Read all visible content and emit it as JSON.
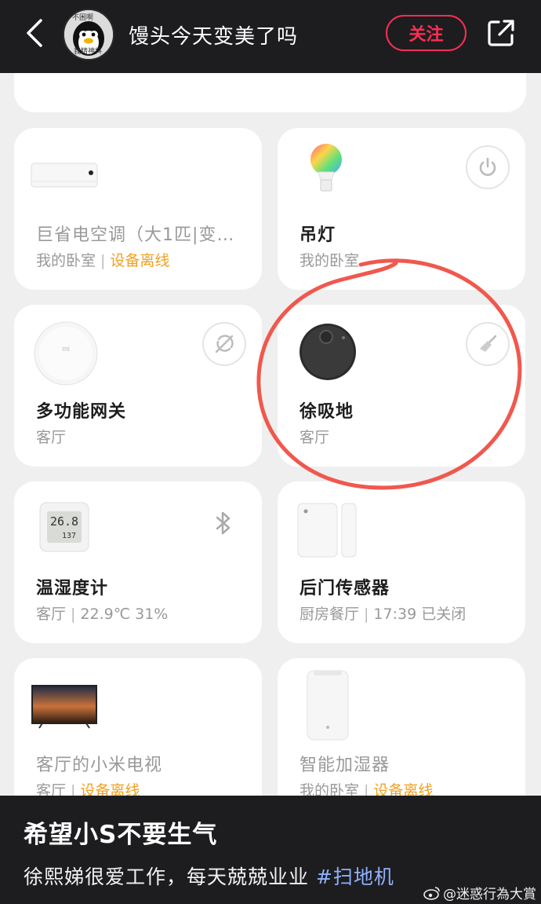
{
  "header": {
    "account_name": "馒头今天变美了吗",
    "avatar_tag_top": "不困啊",
    "avatar_tag_bottom": "我精神抖",
    "follow_label": "关注"
  },
  "devices": [
    {
      "name": "巨省电空调（大1匹|变…",
      "room": "我的卧室",
      "status": "设备离线",
      "icon": "air-conditioner-icon"
    },
    {
      "name": "吊灯",
      "room": "我的卧室",
      "status": "",
      "icon": "smart-bulb-icon",
      "action": "power-icon"
    },
    {
      "name": "多功能网关",
      "room": "客厅",
      "status": "",
      "icon": "gateway-icon",
      "gateway_logo": "mi",
      "action": "offline-icon"
    },
    {
      "name": "徐吸地",
      "room": "客厅",
      "status": "",
      "icon": "robot-vacuum-icon",
      "action": "broom-icon"
    },
    {
      "name": "温湿度计",
      "room": "客厅",
      "status": "22.9℃ 31%",
      "icon": "thermometer-icon",
      "display_temp": "26.8",
      "display_hum": "137",
      "action": "bluetooth-icon"
    },
    {
      "name": "后门传感器",
      "room": "厨房餐厅",
      "status": "17:39 已关闭",
      "icon": "door-sensor-icon"
    },
    {
      "name": "客厅的小米电视",
      "room": "客厅",
      "status": "设备离线",
      "icon": "tv-icon"
    },
    {
      "name": "智能加湿器",
      "room": "我的卧室",
      "status": "设备离线",
      "icon": "humidifier-icon"
    }
  ],
  "caption": {
    "title": "希望小S不要生气",
    "body": "徐熙娣很爱工作，每天兢兢业业 ",
    "hashtag": "#扫地机"
  },
  "watermark": "@迷惑行為大賞",
  "colors": {
    "offline": "#f0a020",
    "follow": "#ff2d55",
    "annotation": "#f0584e",
    "hashtag": "#8fb1ff"
  }
}
